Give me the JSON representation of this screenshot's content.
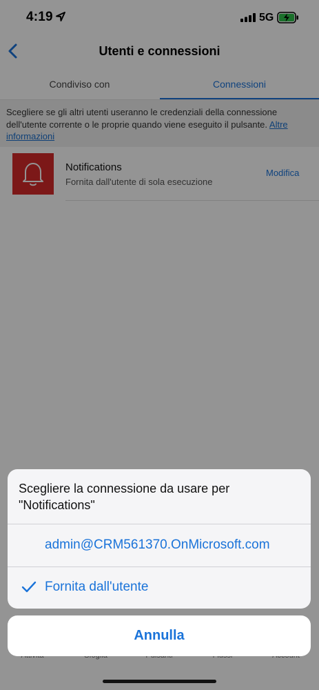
{
  "status_bar": {
    "time": "4:19",
    "network": "5G"
  },
  "header": {
    "title": "Utenti e connessioni"
  },
  "tabs": [
    {
      "label": "Condiviso con"
    },
    {
      "label": "Connessioni"
    }
  ],
  "info": {
    "text": "Scegliere se gli altri utenti useranno le credenziali della connessione dell'utente corrente o le proprie quando viene eseguito il pulsante. ",
    "link": "Altre informazioni"
  },
  "connection": {
    "name": "Notifications",
    "subtitle": "Fornita dall'utente di sola esecuzione",
    "edit_label": "Modifica",
    "icon": "bell-icon",
    "icon_color": "#d62a2a"
  },
  "bottom_tabs": [
    {
      "label": "Attività"
    },
    {
      "label": "Sfoglia"
    },
    {
      "label": "Pulsanti"
    },
    {
      "label": "Flussi"
    },
    {
      "label": "Account"
    }
  ],
  "action_sheet": {
    "title": "Scegliere la connessione da usare per \"Notifications\"",
    "options": [
      {
        "label": "admin@CRM561370.OnMicrosoft.com",
        "selected": false
      },
      {
        "label": "Fornita dall'utente",
        "selected": true
      }
    ],
    "cancel_label": "Annulla"
  },
  "colors": {
    "accent": "#1a73d9",
    "tile": "#d62a2a"
  }
}
